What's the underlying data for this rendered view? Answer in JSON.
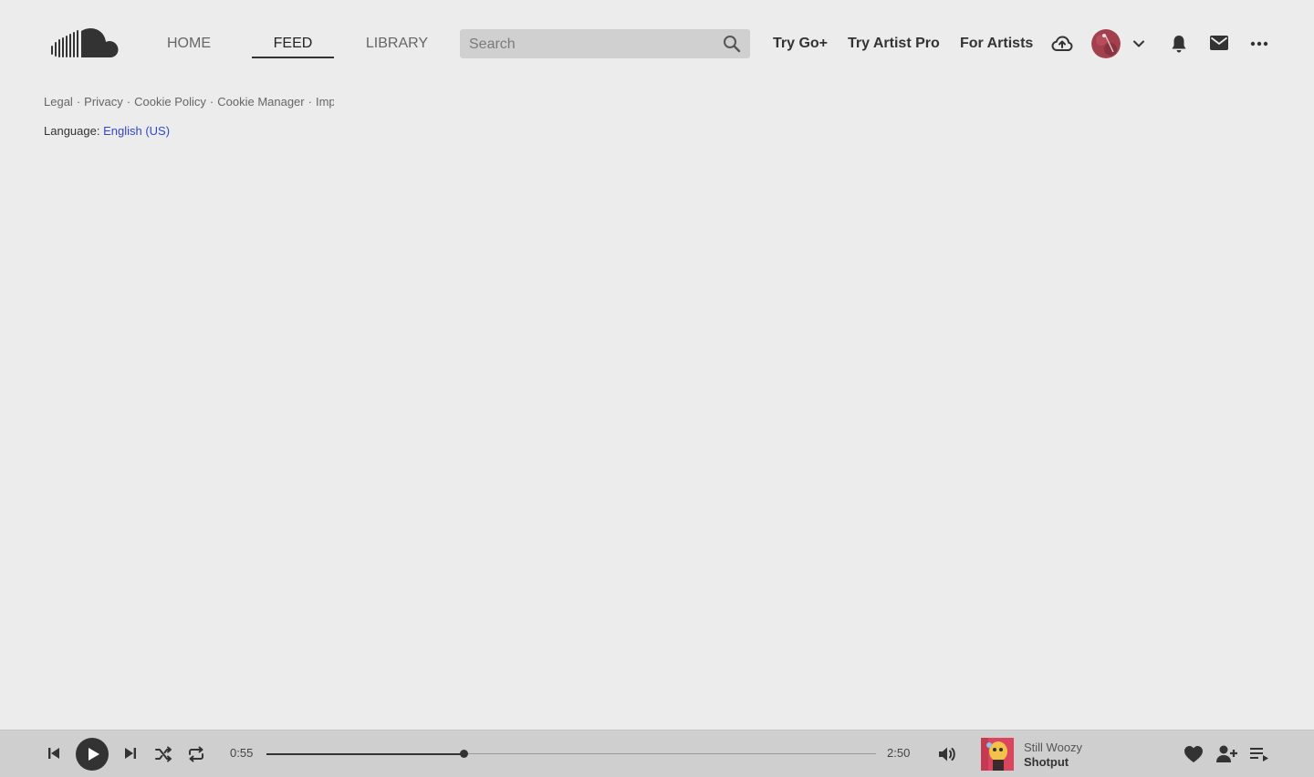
{
  "header": {
    "logo_icon": "soundcloud-logo",
    "nav": [
      {
        "label": "HOME",
        "active": false
      },
      {
        "label": "FEED",
        "active": true
      },
      {
        "label": "LIBRARY",
        "active": false
      }
    ],
    "search": {
      "placeholder": "Search",
      "value": "",
      "icon": "search-icon"
    },
    "links": {
      "try_go_plus": "Try Go+",
      "try_artist_pro": "Try Artist Pro",
      "for_artists": "For Artists"
    },
    "icons": [
      "upload-cloud-icon",
      "avatar",
      "chevron-down-icon",
      "bell-icon",
      "mail-icon",
      "more-icon"
    ]
  },
  "footer": {
    "links": [
      "Legal",
      "Privacy",
      "Cookie Policy",
      "Cookie Manager",
      "Imprint"
    ],
    "separator": "·",
    "language_label": "Language:",
    "language_value": "English (US)"
  },
  "player": {
    "elapsed": "0:55",
    "duration": "2:50",
    "progress_fraction": 0.3235,
    "artist": "Still Woozy",
    "track": "Shotput",
    "icons": [
      "skip-back-icon",
      "play-icon",
      "skip-forward-icon",
      "shuffle-icon",
      "repeat-icon",
      "volume-icon",
      "heart-icon",
      "follow-user-icon",
      "queue-icon"
    ]
  },
  "colors": {
    "background": "#ececec",
    "player_bg": "#cfcfcf",
    "link_blue": "#3347c7",
    "text_dark": "#333333"
  }
}
